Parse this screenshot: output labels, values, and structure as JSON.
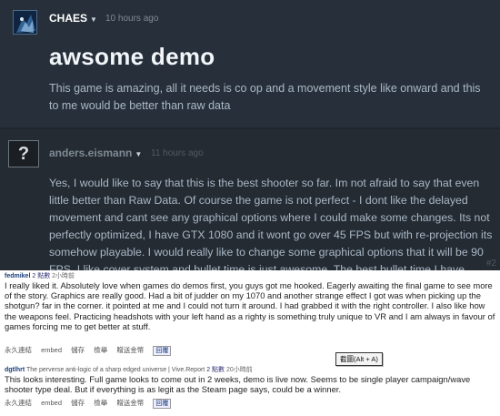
{
  "post1": {
    "author": "CHAES",
    "time": "10 hours ago",
    "title": "awsome demo",
    "body": "This game is amazing, all it needs is co op and a movement style like onward and this to me would be better than raw data"
  },
  "post2": {
    "avatar_glyph": "?",
    "author": "anders.eismann",
    "time": "11 hours ago",
    "body": "Yes, I would like to say that this is the best shooter so far. Im not afraid to say that even little better than Raw Data. Of course the game is not perfect - I dont like the delayed movement and cant see any graphical options where I could make some changes. Its not perfectly optimized, I have GTX 1080 and it wont go over 45 FPS but with re-projection its somehow playable. I would really like to change some graphical options that it will be 90 FPS. I like cover system and bullet time is just awesome. The best bullet time I have seen. Good job, definitely will buy this game when its ready!",
    "post_number": "#2"
  },
  "comment1": {
    "username": "fedmikel",
    "score": "2 點數",
    "time": "2小時前",
    "text": "I really liked it. Absolutely love when games do demos first, you guys got me hooked. Eagerly awaiting the final game to see more of the story. Graphics are really good. Had a bit of judder on my 1070 and another strange effect I got was when picking up the shotgun? far in the corner. it pointed at me and I could not turn it around. I had grabbed it with the right controller. I also like how the weapons feel. Practicing headshots with your left hand as a righty is something truly unique to VR and I am always in favour of games forcing me to get better at stuff.",
    "actions": [
      "永久連結",
      "embed",
      "儲存",
      "檢舉",
      "贈送金幣",
      "回覆"
    ]
  },
  "tooltip": "截圖(Alt + A)",
  "comment2": {
    "username": "dgtlhrt",
    "flair": "The perverse anti-logic of a sharp edged universe | Vive.Report",
    "score": "2 點數",
    "time": "20小時前",
    "text": "This looks interesting. Full game looks to come out in 2 weeks, demo is live now. Seems to be single player campaign/wave shooter type deal. But if everything is as legit as the Steam page says, could be a winner.",
    "actions": [
      "永久連結",
      "embed",
      "儲存",
      "檢舉",
      "贈送金幣",
      "回覆"
    ]
  }
}
